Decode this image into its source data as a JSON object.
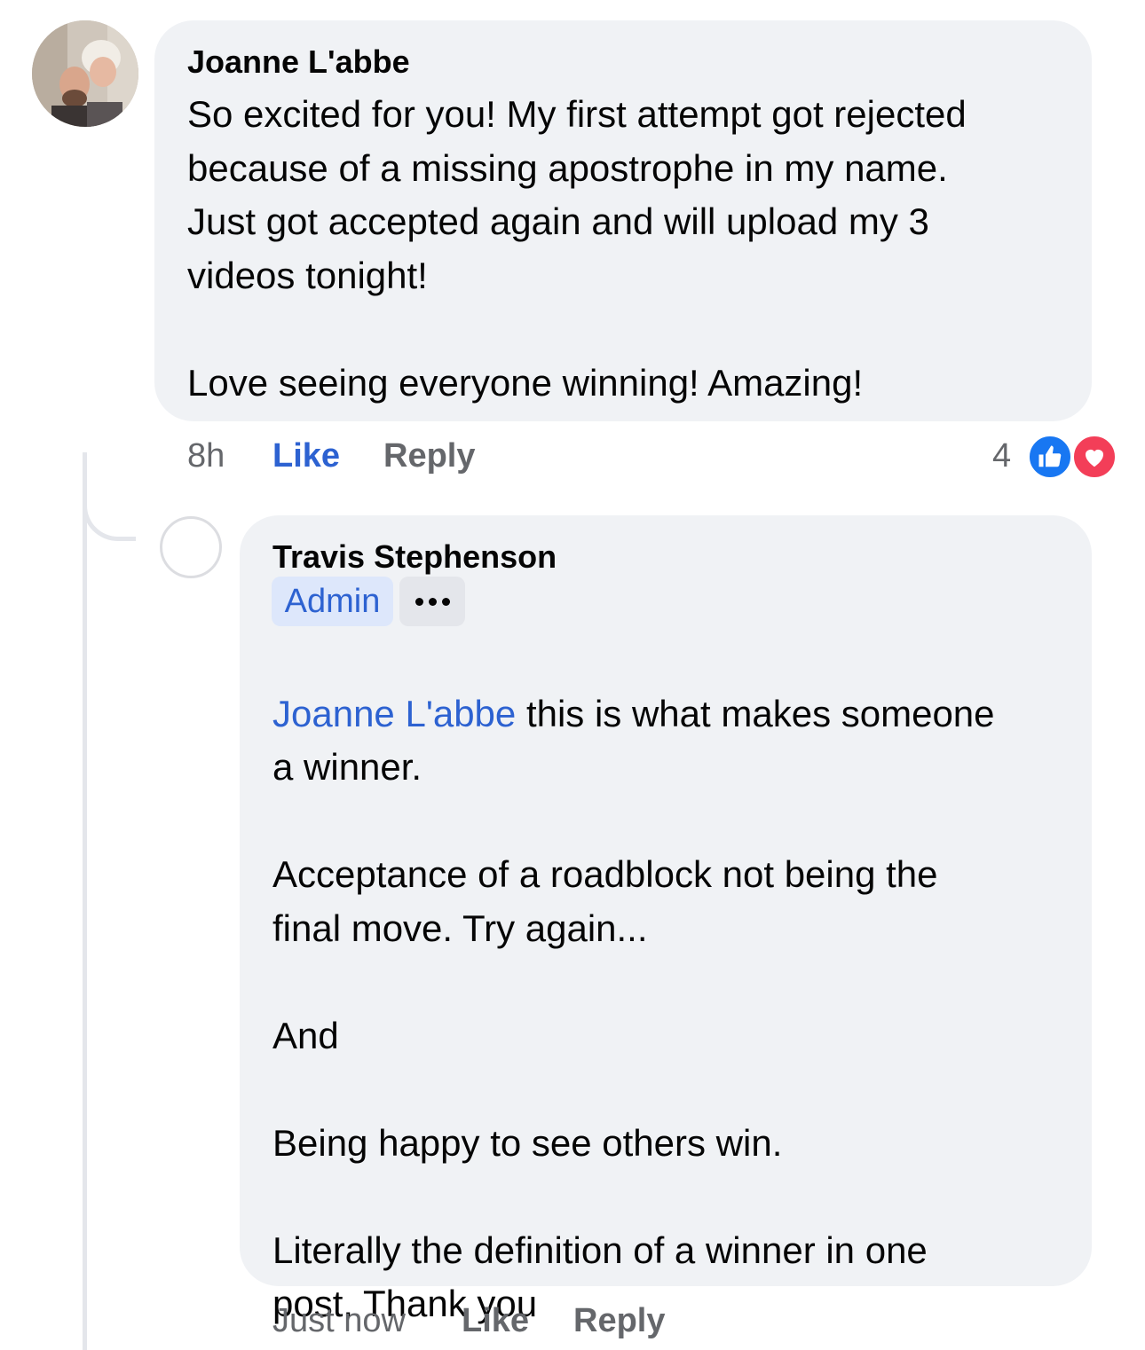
{
  "colors": {
    "bubble": "#f0f2f5",
    "link_blue": "#2d62d1",
    "muted_text": "#65676b",
    "like_reaction": "#1877f2",
    "love_reaction": "#f33e58"
  },
  "comment": {
    "author": "Joanne L'abbe",
    "text": "So excited for you! My first attempt got rejected\nbecause of a missing apostrophe in my name.\nJust got accepted again and will upload my 3\nvideos tonight!\n\nLove seeing everyone winning! Amazing!",
    "time": "8h",
    "like_label": "Like",
    "reply_label": "Reply",
    "reaction_count": "4",
    "reactions": [
      "like-icon",
      "love-icon"
    ]
  },
  "reply": {
    "author": "Travis Stephenson",
    "badge": "Admin",
    "more_icon": "more-icon",
    "mention": "Joanne L'abbe",
    "text_first_line": " this is what makes someone",
    "text_rest": "a winner.\n\nAcceptance of a roadblock not being the\nfinal move. Try again...\n\nAnd\n\nBeing happy to see others win.\n\nLiterally the definition of a winner in one\npost. Thank you",
    "time": "Just now",
    "like_label": "Like",
    "reply_label": "Reply"
  }
}
